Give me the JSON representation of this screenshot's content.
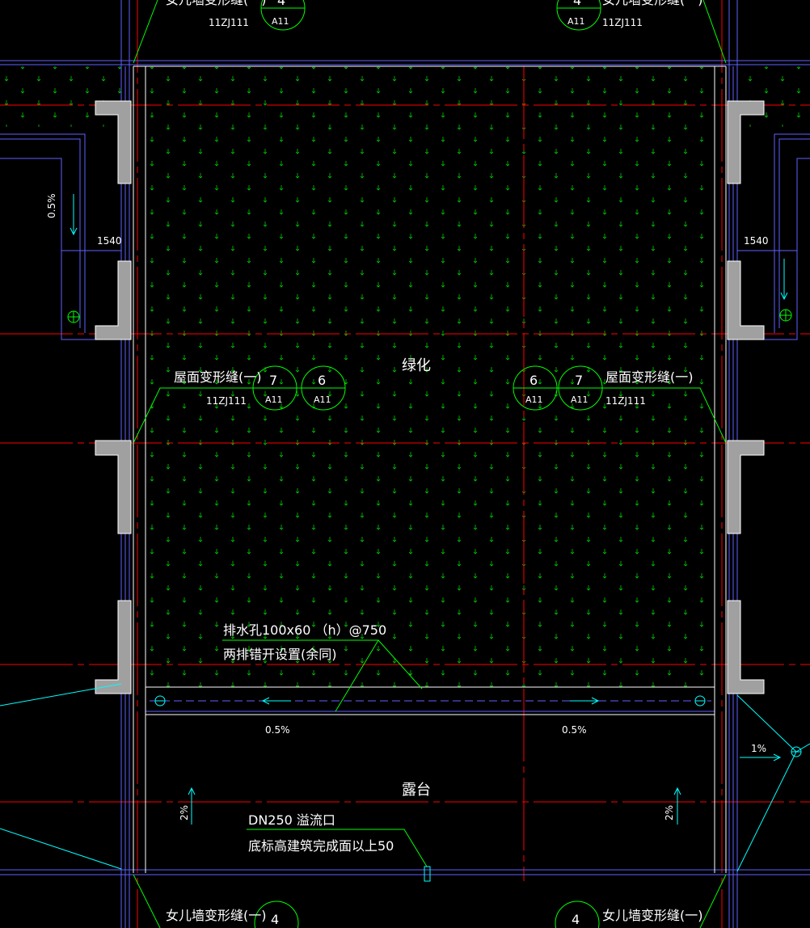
{
  "drawing": {
    "greenery_label": "绿化",
    "terrace_label": "露台",
    "detail_refs": {
      "parapet_joint": "女儿墙变形缝(一)",
      "roof_joint": "屋面变形缝(一)",
      "atlas": "11ZJ111",
      "sheet": "A11",
      "bubble_4": "4",
      "bubble_6": "6",
      "bubble_7": "7"
    },
    "drain_note": {
      "line1": "排水孔100x60 （h）@750",
      "line2": "两排错开设置(余同)"
    },
    "overflow_note": {
      "line1": "DN250   溢流口",
      "line2": "底标高建筑完成面以上50"
    },
    "dimensions": {
      "width_left": "1540",
      "width_right": "1540"
    },
    "slopes": {
      "gutter_left": "0.5%",
      "gutter_right": "0.5%",
      "side_left": "0.5%",
      "terrace_left": "2%",
      "terrace_right": "2%",
      "outer_right": "1%"
    },
    "colors": {
      "background": "#000000",
      "axis_line": "#ff0000",
      "wall_line": "#6060ff",
      "leader_line": "#00ff00",
      "cyan_line": "#00ffff",
      "column_fill": "#a0a0a0",
      "text": "#ffffff",
      "hatch_mark": "#00c800"
    }
  }
}
